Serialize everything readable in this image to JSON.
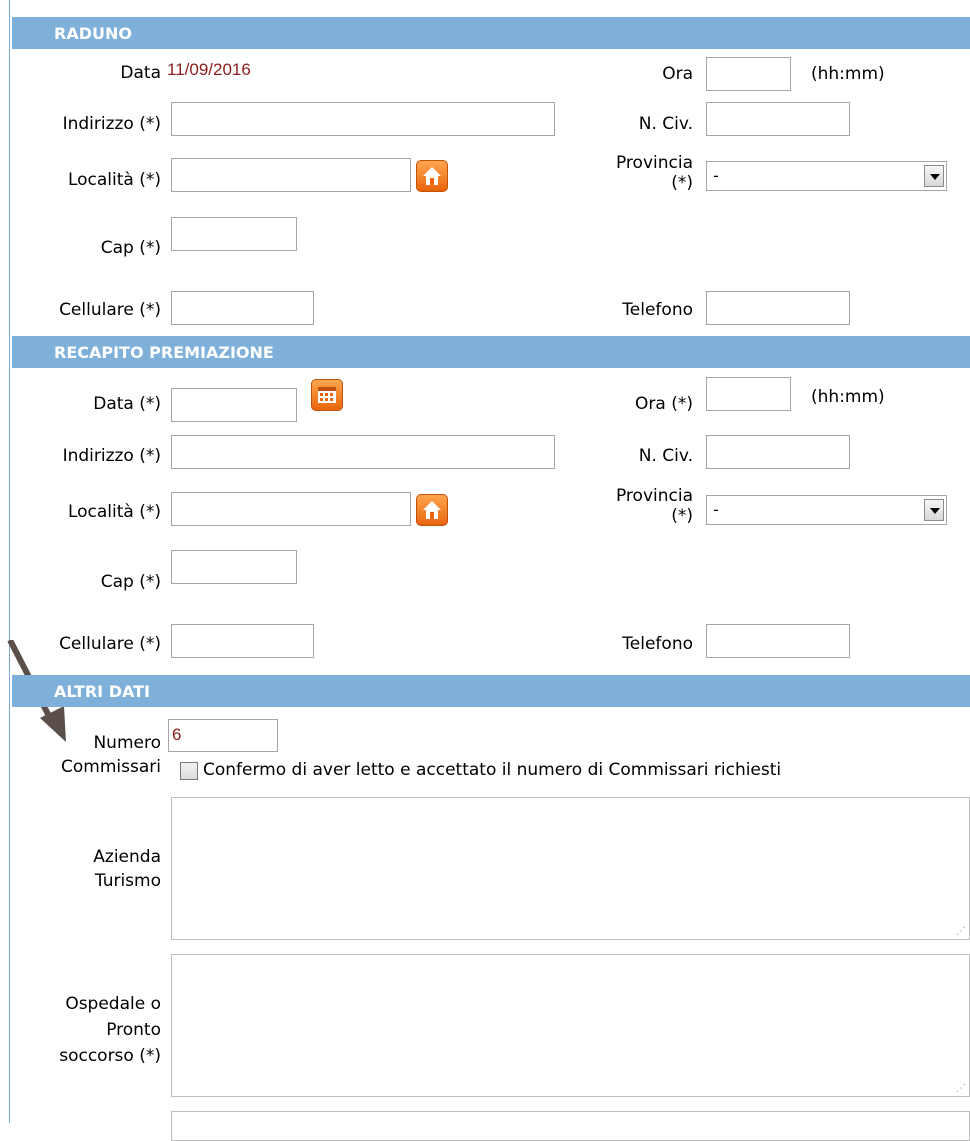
{
  "raduno": {
    "header": "RADUNO",
    "data_label": "Data",
    "data_value": "11/09/2016",
    "ora_label": "Ora",
    "ora_value": "",
    "ora_unit": "(hh:mm)",
    "indirizzo_label": "Indirizzo (*)",
    "indirizzo_value": "",
    "nciv_label": "N. Civ.",
    "nciv_value": "",
    "localita_label": "Località (*)",
    "localita_value": "",
    "provincia_label_1": "Provincia",
    "provincia_label_2": "(*)",
    "provincia_value": "-",
    "cap_label": "Cap (*)",
    "cap_value": "",
    "cellulare_label": "Cellulare (*)",
    "cellulare_value": "",
    "telefono_label": "Telefono",
    "telefono_value": "",
    "home_icon": "home-icon"
  },
  "recapito": {
    "header": "RECAPITO PREMIAZIONE",
    "data_label": "Data (*)",
    "data_value": "",
    "ora_label": "Ora (*)",
    "ora_value": "",
    "ora_unit": "(hh:mm)",
    "indirizzo_label": "Indirizzo (*)",
    "indirizzo_value": "",
    "nciv_label": "N. Civ.",
    "nciv_value": "",
    "localita_label": "Località (*)",
    "localita_value": "",
    "provincia_label_1": "Provincia",
    "provincia_label_2": "(*)",
    "provincia_value": "-",
    "cap_label": "Cap (*)",
    "cap_value": "",
    "cellulare_label": "Cellulare (*)",
    "cellulare_value": "",
    "telefono_label": "Telefono",
    "telefono_value": "",
    "calendar_icon": "calendar-icon",
    "home_icon": "home-icon"
  },
  "altri": {
    "header": "ALTRI DATI",
    "numero_label_1": "Numero",
    "numero_label_2": "Commissari",
    "numero_value": "6",
    "conferma_label": "Confermo di aver letto e accettato il numero di Commissari richiesti",
    "azienda_label_1": "Azienda",
    "azienda_label_2": "Turismo",
    "azienda_value": "",
    "ospedale_label_1": "Ospedale o",
    "ospedale_label_2": "Pronto",
    "ospedale_label_3": "soccorso (*)",
    "ospedale_value": ""
  },
  "colors": {
    "header_bg": "#7eb0da",
    "value_text": "#8b1c1c",
    "icon_orange": "#f07a1a",
    "annotation_arrow": "#5a4f49"
  }
}
